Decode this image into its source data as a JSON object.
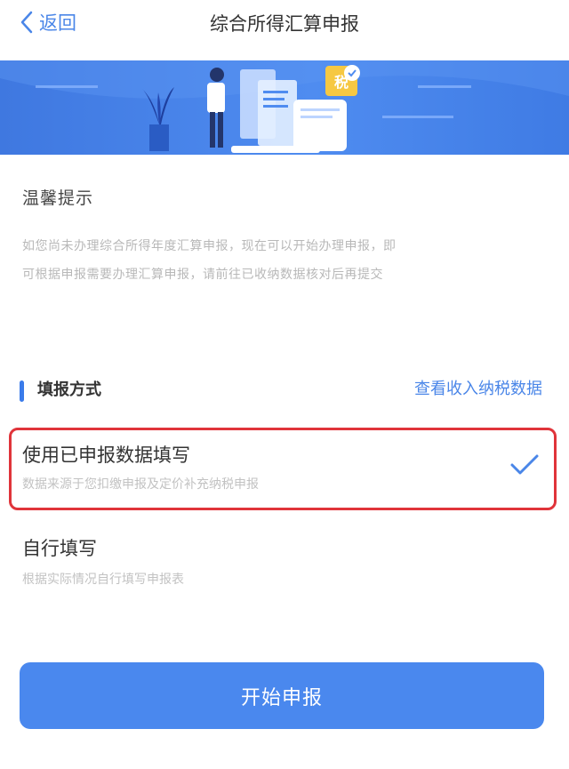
{
  "nav": {
    "back_label": "返回",
    "title": "综合所得汇算申报"
  },
  "banner": {
    "tax_badge": "税",
    "arrows": "<<<<"
  },
  "tips": {
    "title": "温馨提示",
    "line1": "如您尚未办理综合所得年度汇算申报，现在可以开始办理申报，即",
    "line2": "可根据申报需要办理汇算申报，请前往已收纳数据核对后再提交"
  },
  "section": {
    "title": "填报方式",
    "link": "查看收入纳税数据"
  },
  "options": [
    {
      "title": "使用已申报数据填写",
      "desc": "数据来源于您扣缴申报及定价补充纳税申报",
      "selected": true
    },
    {
      "title": "自行填写",
      "desc": "根据实际情况自行填写申报表"
    }
  ],
  "actions": {
    "start_label": "开始申报"
  },
  "colors": {
    "accent": "#4a86e8",
    "primary_button": "#4a88ee",
    "selection_border": "#e0343a",
    "banner": "#4f8cf0"
  }
}
